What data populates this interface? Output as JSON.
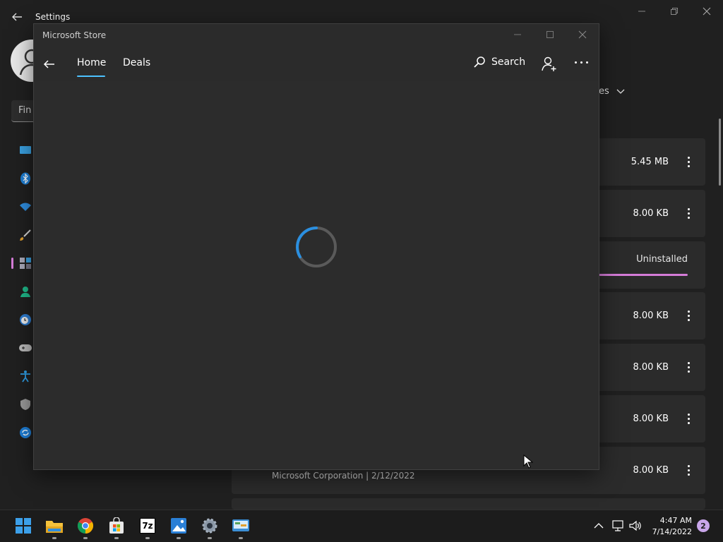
{
  "settings": {
    "title": "Settings",
    "find_placeholder": "Fin",
    "sort_fragment": "es",
    "nav_icons": [
      "display-icon",
      "bluetooth-icon",
      "wifi-icon",
      "brush-icon",
      "apps-icon",
      "account-icon",
      "clock-icon",
      "gaming-icon",
      "accessibility-icon",
      "shield-icon",
      "update-icon"
    ],
    "rows": [
      {
        "size": "5.45 MB"
      },
      {
        "size": "8.00 KB"
      },
      {
        "status": "Uninstalled"
      },
      {
        "size": "8.00 KB"
      },
      {
        "size": "8.00 KB"
      },
      {
        "size": "8.00 KB"
      },
      {
        "size": "8.00 KB",
        "publisher": "Microsoft Corporation  |  2/12/2022"
      }
    ]
  },
  "store": {
    "title": "Microsoft Store",
    "tabs": [
      "Home",
      "Deals"
    ],
    "active_tab": "Home",
    "search_label": "Search",
    "accent": "#4cc2ff"
  },
  "taskbar": {
    "apps": [
      "start-icon",
      "file-explorer-icon",
      "chrome-icon",
      "store-icon",
      "7zip-icon",
      "photos-icon",
      "settings-icon",
      "control-panel-icon"
    ],
    "zip_label": "7z",
    "time": "4:47 AM",
    "date": "7/14/2022",
    "notification_count": "2"
  },
  "colors": {
    "accent_pink": "#d57cd8",
    "accent_blue": "#4cc2ff",
    "background": "#202020"
  }
}
